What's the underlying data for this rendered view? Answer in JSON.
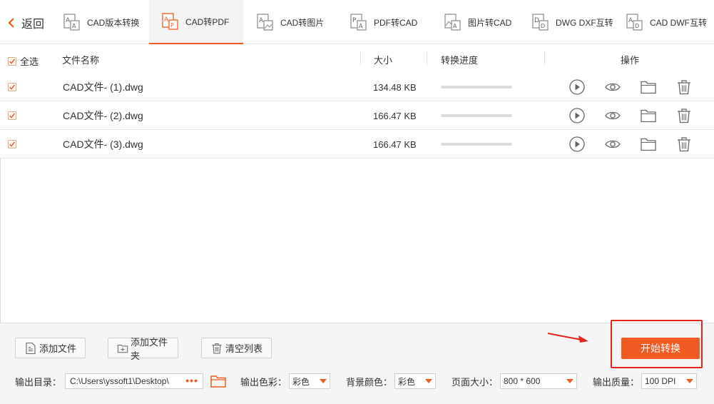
{
  "topbar": {
    "back_label": "返回",
    "tabs": [
      {
        "label": "CAD版本转换",
        "active": false
      },
      {
        "label": "CAD转PDF",
        "active": true
      },
      {
        "label": "CAD转图片",
        "active": false
      },
      {
        "label": "PDF转CAD",
        "active": false
      },
      {
        "label": "图片转CAD",
        "active": false
      },
      {
        "label": "DWG DXF互转",
        "active": false
      },
      {
        "label": "CAD DWF互转",
        "active": false
      }
    ]
  },
  "table": {
    "select_all_label": "全选",
    "columns": {
      "name": "文件名称",
      "size": "大小",
      "progress": "转换进度",
      "actions": "操作"
    },
    "rows": [
      {
        "name": "CAD文件- (1).dwg",
        "size": "134.48 KB",
        "progress": 0,
        "checked": true
      },
      {
        "name": "CAD文件- (2).dwg",
        "size": "166.47 KB",
        "progress": 0,
        "checked": true
      },
      {
        "name": "CAD文件- (3).dwg",
        "size": "166.47 KB",
        "progress": 0,
        "checked": true
      }
    ]
  },
  "panel": {
    "add_file": "添加文件",
    "add_folder": "添加文件夹",
    "clear_list": "清空列表",
    "start": "开始转换",
    "output_dir_label": "输出目录：",
    "output_dir_value": "C:\\Users\\yssoft1\\Desktop\\",
    "dots": "•••",
    "color_label": "输出色彩：",
    "color_value": "彩色",
    "bg_label": "背景颜色：",
    "bg_value": "彩色",
    "page_size_label": "页面大小：",
    "page_size_value": "800 * 600",
    "quality_label": "输出质量：",
    "quality_value": "100 DPI"
  },
  "colors": {
    "accent": "#f15a22",
    "highlight": "#e8231b"
  }
}
